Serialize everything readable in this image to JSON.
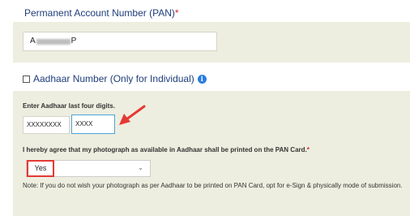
{
  "pan": {
    "label": "Permanent Account Number (PAN)",
    "required_mark": "*",
    "value_prefix": "A",
    "value_suffix": "P"
  },
  "aadhaar": {
    "checkbox_label": "Aadhaar Number (Only for Individual)",
    "info_icon": "info-icon",
    "enter_label": "Enter Aadhaar last four digits.",
    "first_value": "XXXXXXXX",
    "last_value": "XXXX"
  },
  "photo": {
    "label": "I hereby agree that my photograph as available in Aadhaar shall be printed on the PAN Card.",
    "required_mark": "*",
    "selected": "Yes",
    "chevron_icon": "chevron-down-icon"
  },
  "note": "Note: If you do not wish your photograph as per Aadhaar to be printed on PAN Card, opt for e-Sign & physically mode of submission.",
  "colors": {
    "panel_bg": "#eeeee0",
    "label_blue": "#1f3d7a",
    "required_red": "#d9272e",
    "highlight_red": "#e53935",
    "focus_blue": "#4da3d8"
  }
}
